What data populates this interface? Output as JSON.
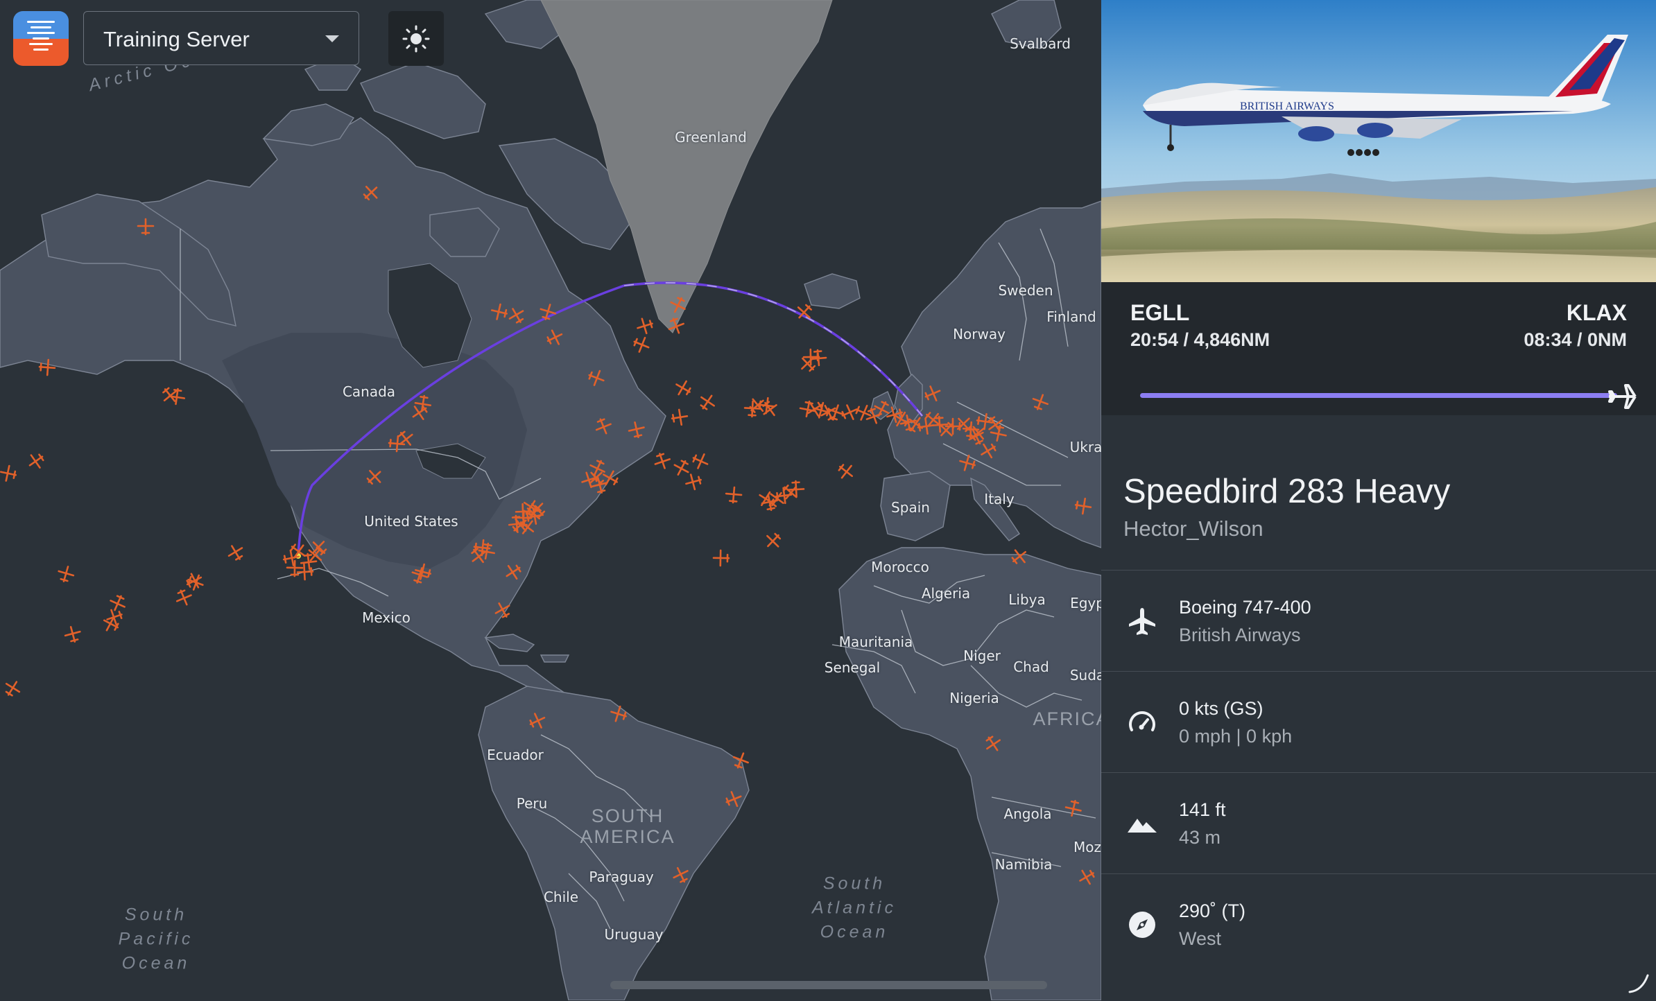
{
  "toolbar": {
    "server_label": "Training Server",
    "theme_icon": "sun-icon"
  },
  "map": {
    "ocean_labels": [
      {
        "text": "Arctic Ocean"
      },
      {
        "text": "South\nPacific\nOcean"
      },
      {
        "text": "South\nAtlantic\nOcean"
      }
    ],
    "country_labels": [
      "Svalbard",
      "Greenland",
      "Sweden",
      "Finland",
      "Norway",
      "Canada",
      "United States",
      "Mexico",
      "Spain",
      "Italy",
      "Ukra",
      "Morocco",
      "Algeria",
      "Libya",
      "Egyp",
      "Mauritania",
      "Niger",
      "Chad",
      "Senegal",
      "Suda",
      "Nigeria",
      "Ecuador",
      "Peru",
      "Chile",
      "Paraguay",
      "Uruguay",
      "Angola",
      "Namibia",
      "Moz"
    ],
    "continent_labels": [
      "SOUTH\nAMERICA",
      "AFRICA"
    ],
    "route_color": "#6a3fe0",
    "aircraft_color": "#e2612a"
  },
  "flight": {
    "departure": {
      "code": "EGLL",
      "meta": "20:54 / 4,846NM"
    },
    "arrival": {
      "code": "KLAX",
      "meta": "08:34 / 0NM"
    },
    "progress": 1.0,
    "progress_color": "#8c7ef2",
    "callsign": "Speedbird 283 Heavy",
    "pilot": "Hector_Wilson",
    "aircraft": {
      "type": "Boeing 747-400",
      "airline": "British Airways",
      "icon": "airplane-icon"
    },
    "speed": {
      "primary": "0 kts (GS)",
      "secondary": "0 mph | 0 kph",
      "icon": "speedometer-icon"
    },
    "altitude": {
      "primary": "141 ft",
      "secondary": "43 m",
      "icon": "mountain-icon"
    },
    "heading": {
      "primary": "290˚ (T)",
      "secondary": "West",
      "icon": "compass-icon"
    }
  }
}
